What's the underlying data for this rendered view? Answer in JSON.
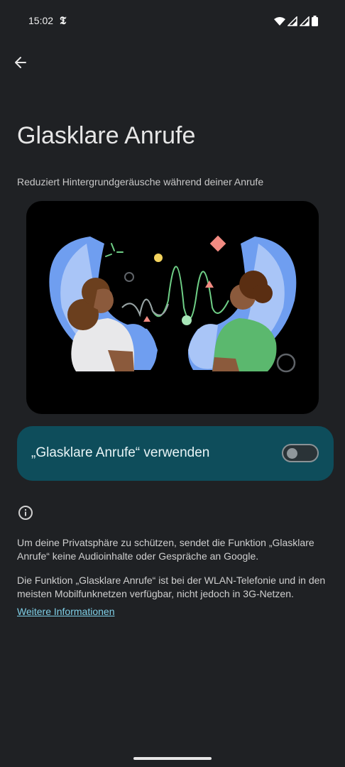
{
  "status_bar": {
    "time": "15:02",
    "app_glyph": "𝕿"
  },
  "header": {
    "back_icon": "arrow-left-icon"
  },
  "page": {
    "title": "Glasklare Anrufe",
    "subtitle": "Reduziert Hintergrundgeräusche während deiner Anrufe"
  },
  "toggle": {
    "label": "„Glasklare Anrufe“ verwenden",
    "state": "off"
  },
  "info": {
    "paragraph_1": "Um deine Privatsphäre zu schützen, sendet die Funktion „Glasklare Anrufe“ keine Audioinhalte oder Gespräche an Google.",
    "paragraph_2": "Die Funktion „Glasklare Anrufe“ ist bei der WLAN-Telefonie und in den meisten Mobilfunknetzen verfügbar, nicht jedoch in 3G-Netzen.",
    "link": "Weitere Informationen"
  },
  "colors": {
    "background": "#1f2124",
    "card": "#0e4d5b",
    "link": "#7fd0e8"
  }
}
